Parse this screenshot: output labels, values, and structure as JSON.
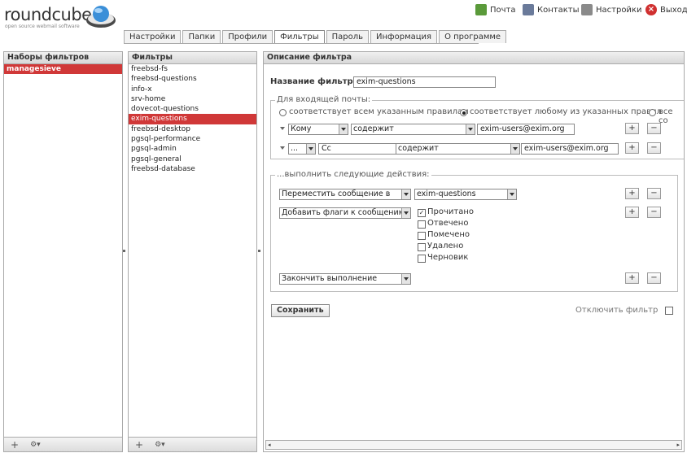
{
  "app": {
    "logo_text": "roundcube",
    "logo_tagline": "open source webmail software"
  },
  "topnav": {
    "mail": "Почта",
    "contacts": "Контакты",
    "settings": "Настройки",
    "logout": "Выход"
  },
  "tabs": [
    "Настройки",
    "Папки",
    "Профили",
    "Фильтры",
    "Пароль",
    "Информация",
    "О программе"
  ],
  "filtersets": {
    "title": "Наборы фильтров",
    "items": [
      "managesieve"
    ]
  },
  "filters": {
    "title": "Фильтры",
    "items": [
      "freebsd-fs",
      "freebsd-questions",
      "info-x",
      "srv-home",
      "dovecot-questions",
      "exim-questions",
      "freebsd-desktop",
      "pgsql-performance",
      "pgsql-admin",
      "pgsql-general",
      "freebsd-database"
    ],
    "selected": "exim-questions"
  },
  "footer": {
    "add": "+",
    "actions": "⚙▾"
  },
  "detail": {
    "title": "Описание фильтра",
    "name_label": "Название фильтра:",
    "name_value": "exim-questions",
    "incoming_legend": "Для входящей почты:",
    "match_all": "соответствует всем указанным правилам",
    "match_any": "соответствует любому из указанных правил",
    "match_all_msgs": "все со",
    "rules": [
      {
        "header": "Кому",
        "header_custom": "",
        "op": "содержит",
        "value": "exim-users@exim.org"
      },
      {
        "header": "...",
        "header_custom": "Cc",
        "op": "содержит",
        "value": "exim-users@exim.org"
      }
    ],
    "actions_legend": "...выполнить следующие действия:",
    "action1": "Переместить сообщение в",
    "action1_target": "exim-questions",
    "action2": "Добавить флаги к сообщению",
    "flags": [
      "Прочитано",
      "Отвечено",
      "Помечено",
      "Удалено",
      "Черновик"
    ],
    "flags_checked": [
      true,
      false,
      false,
      false,
      false
    ],
    "action3": "Закончить выполнение",
    "save": "Сохранить",
    "disable": "Отключить фильтр",
    "plus": "+",
    "minus": "−"
  },
  "colors": {
    "accent": "#d03838",
    "header_grad": "#d8d8d8"
  }
}
